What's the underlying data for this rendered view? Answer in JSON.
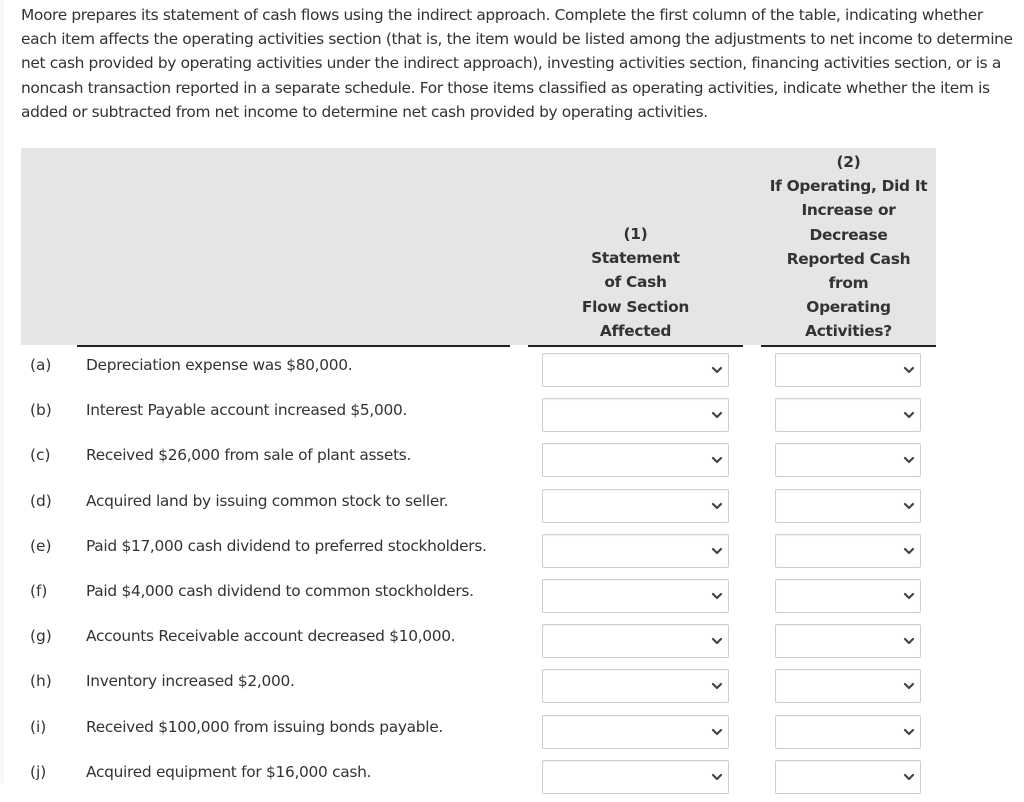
{
  "instructions": "Moore prepares its statement of cash flows using the indirect approach. Complete the first column of the table, indicating whether each item affects the operating activities section (that is, the item would be listed among the adjustments to net income to determine net cash provided by operating activities under the indirect approach), investing activities section, financing activities section, or is a noncash transaction reported in a separate schedule. For those items classified as operating activities, indicate whether the item is added or subtracted from net income to determine net cash provided by operating activities.",
  "table": {
    "columns": [
      {
        "number": "(1)",
        "lines": [
          "Statement",
          "of Cash",
          "Flow Section",
          "Affected"
        ]
      },
      {
        "number": "(2)",
        "lines": [
          "If Operating, Did It",
          "Increase or",
          "Decrease",
          "Reported Cash",
          "from",
          "Operating",
          "Activities?"
        ]
      }
    ],
    "rows": [
      {
        "letter": "(a)",
        "text": "Depreciation expense was $80,000.",
        "section": "",
        "effect": ""
      },
      {
        "letter": "(b)",
        "text": "Interest Payable account increased $5,000.",
        "section": "",
        "effect": ""
      },
      {
        "letter": "(c)",
        "text": "Received $26,000 from sale of plant assets.",
        "section": "",
        "effect": ""
      },
      {
        "letter": "(d)",
        "text": "Acquired land by issuing common stock to seller.",
        "section": "",
        "effect": ""
      },
      {
        "letter": "(e)",
        "text": "Paid $17,000 cash dividend to preferred stockholders.",
        "section": "",
        "effect": ""
      },
      {
        "letter": "(f)",
        "text": "Paid $4,000 cash dividend to common stockholders.",
        "section": "",
        "effect": ""
      },
      {
        "letter": "(g)",
        "text": "Accounts Receivable account decreased $10,000.",
        "section": "",
        "effect": ""
      },
      {
        "letter": "(h)",
        "text": "Inventory increased $2,000.",
        "section": "",
        "effect": ""
      },
      {
        "letter": "(i)",
        "text": "Received $100,000 from issuing bonds payable.",
        "section": "",
        "effect": ""
      },
      {
        "letter": "(j)",
        "text": "Acquired equipment for $16,000 cash.",
        "section": "",
        "effect": ""
      }
    ]
  },
  "icons": {
    "dropdown": "chevron-down-icon"
  }
}
